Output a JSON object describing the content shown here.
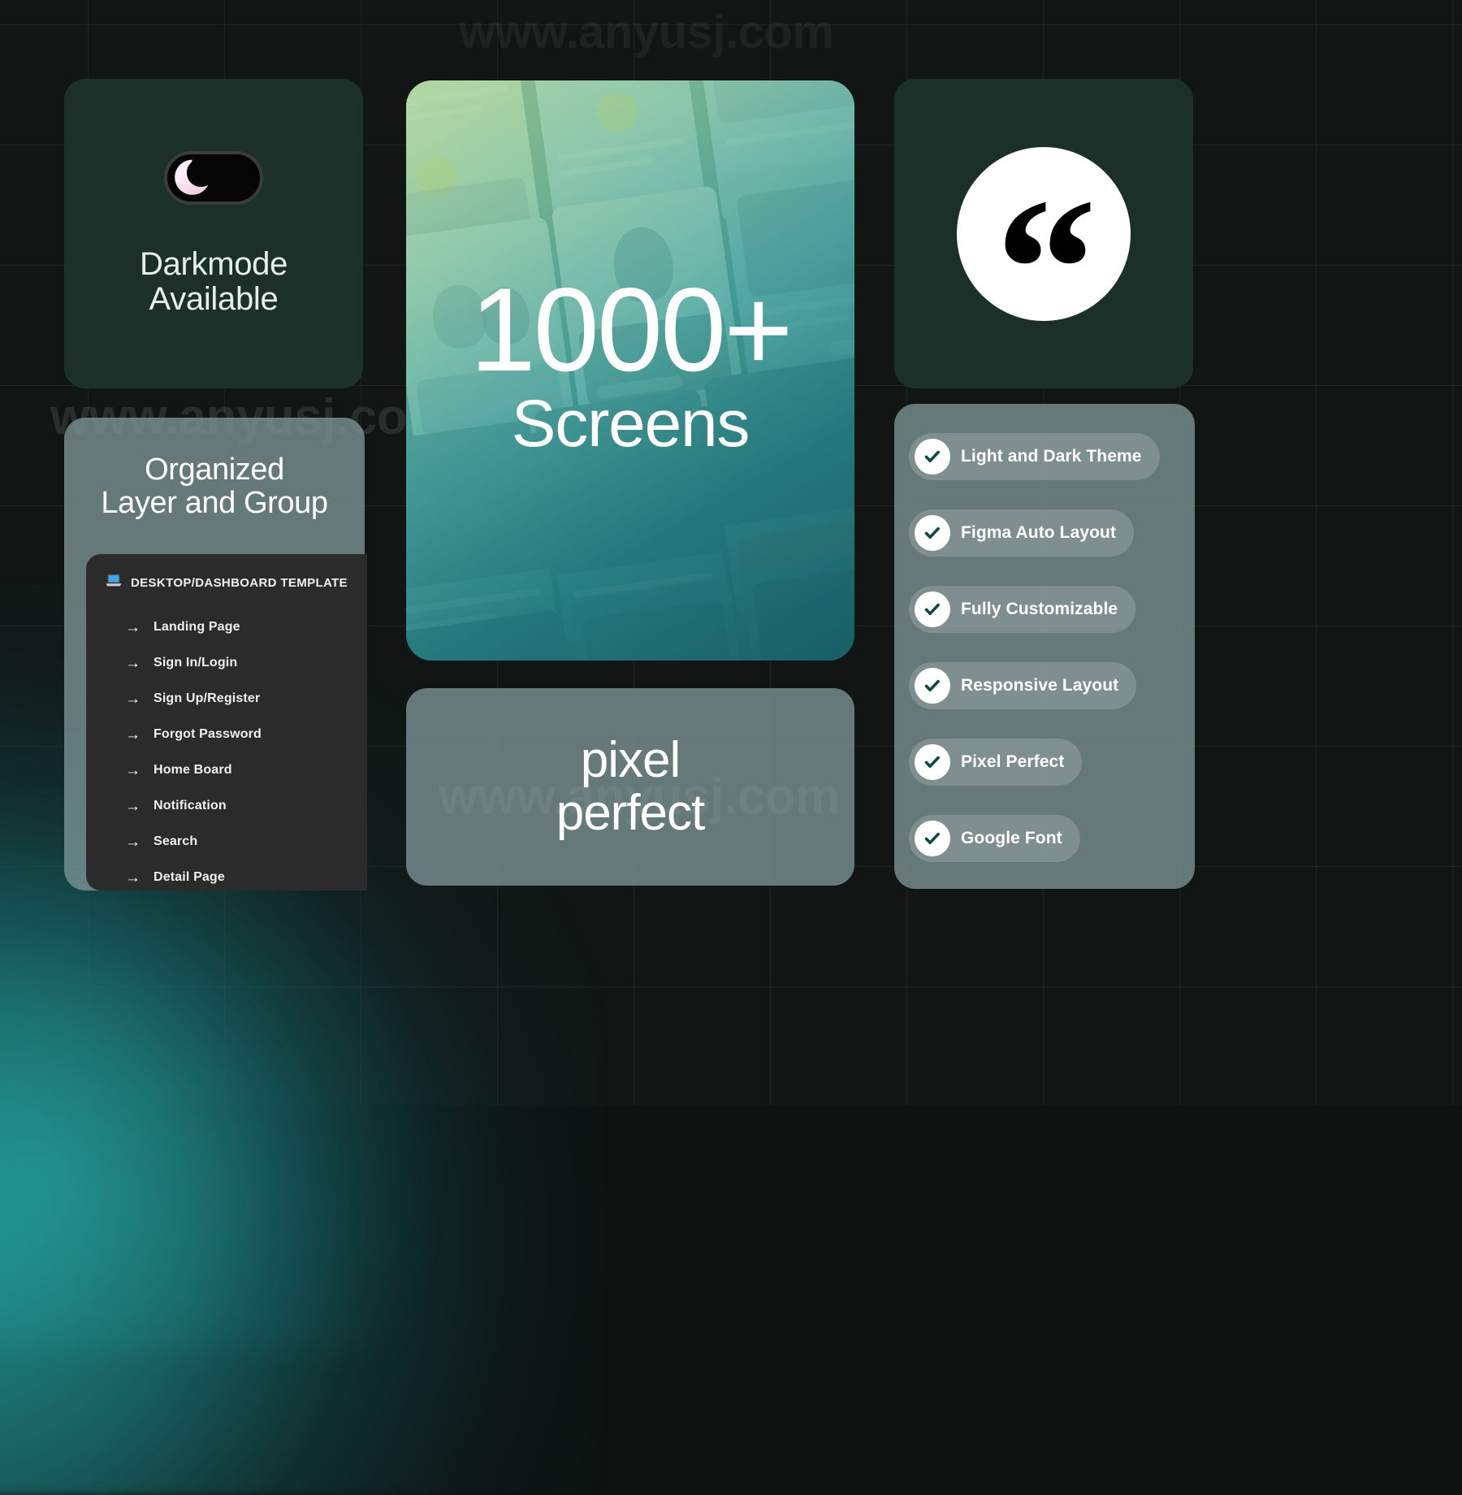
{
  "watermark": {
    "top": "www.anyusj.com",
    "middle": "www.anyusj.com",
    "bottom": "www.anyusj.com"
  },
  "darkmode_card": {
    "toggle_icon": "crescent-moon-icon",
    "title_line1": "Darkmode",
    "title_line2": "Available"
  },
  "layers_card": {
    "title_line1": "Organized",
    "title_line2": "Layer and Group",
    "panel": {
      "header_icon": "laptop-icon",
      "header": "DESKTOP/DASHBOARD TEMPLATE",
      "arrow_glyph": "→",
      "items": [
        "Landing Page",
        "Sign In/Login",
        "Sign Up/Register",
        "Forgot Password",
        "Home Board",
        "Notification",
        "Search",
        "Detail Page"
      ]
    }
  },
  "screens_card": {
    "count": "1000+",
    "label": "Screens"
  },
  "quote_card": {
    "glyph": "“",
    "icon_name": "quotation-mark-icon"
  },
  "pixel_card": {
    "line1": "pixel",
    "line2": "perfect"
  },
  "features_card": {
    "items": [
      {
        "label": "Light and Dark Theme",
        "icon": "check-circle-icon"
      },
      {
        "label": "Figma Auto Layout",
        "icon": "check-circle-icon"
      },
      {
        "label": "Fully Customizable",
        "icon": "check-circle-icon"
      },
      {
        "label": "Responsive Layout",
        "icon": "check-circle-icon"
      },
      {
        "label": "Pixel Perfect",
        "icon": "check-circle-icon"
      },
      {
        "label": "Google Font",
        "icon": "check-circle-icon"
      }
    ]
  },
  "colors": {
    "background": "#111614",
    "card_dark_green": "#1b3029",
    "card_slate": "#7a9292",
    "glow_teal": "#229692",
    "check_teal": "#0d4a44",
    "text_white": "#ffffff",
    "panel_dark": "#2b2b2b"
  }
}
